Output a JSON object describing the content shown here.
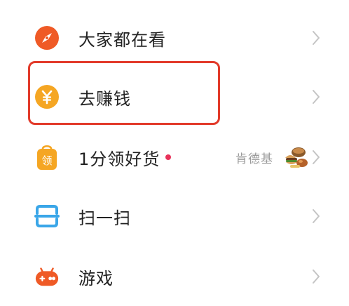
{
  "menu": {
    "items": [
      {
        "label": "大家都在看",
        "icon": "compass-icon",
        "color": "#ef5a26"
      },
      {
        "label": "去赚钱",
        "icon": "yuan-coin-icon",
        "color": "#f5a623",
        "highlighted": true
      },
      {
        "label": "1分领好货",
        "icon": "shopping-bag-icon",
        "color": "#f5a623",
        "icon_text": "领",
        "has_badge_dot": true,
        "extra_text": "肯德基",
        "extra_thumbnail": "food-thumbnail"
      },
      {
        "label": "扫一扫",
        "icon": "scan-icon",
        "color": "#3aa6e8"
      },
      {
        "label": "游戏",
        "icon": "gamepad-icon",
        "color": "#ef5a26"
      }
    ]
  },
  "colors": {
    "highlight_border": "#e23a2a",
    "badge_dot": "#e8325a",
    "chevron": "#c4c4c4"
  }
}
